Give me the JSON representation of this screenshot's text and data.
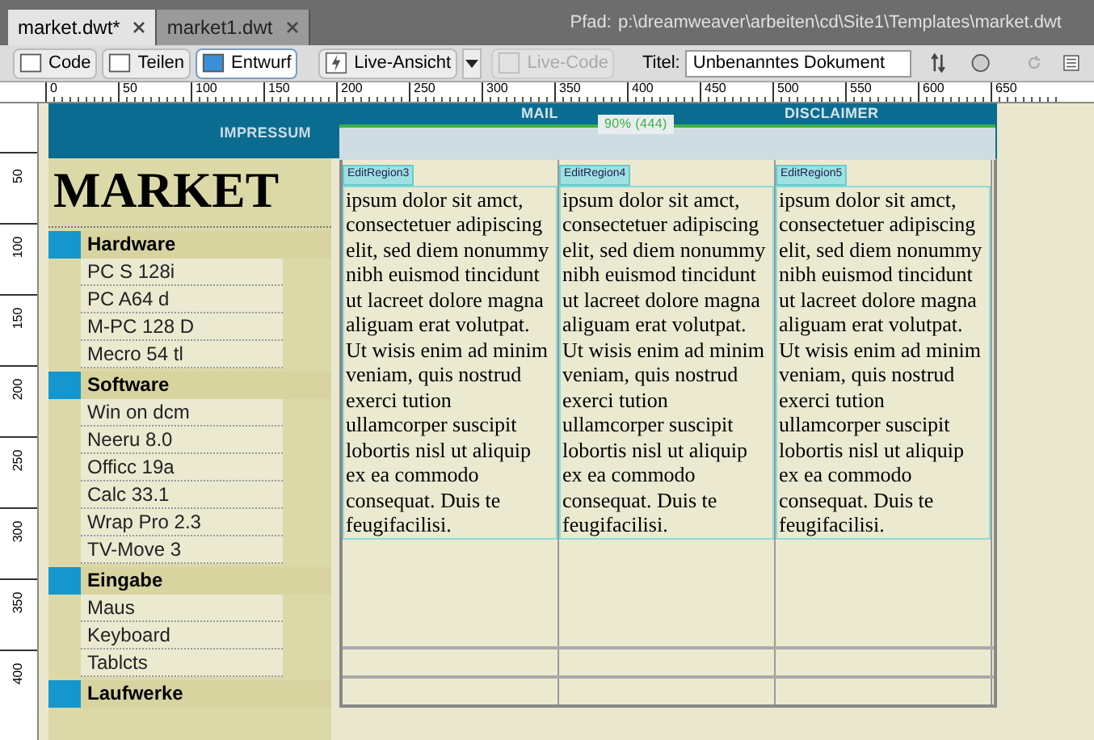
{
  "tabs": [
    {
      "label": "market.dwt*",
      "selected": true
    },
    {
      "label": "market1.dwt",
      "selected": false
    }
  ],
  "path": {
    "label": "Pfad:",
    "value": "p:\\dreamweaver\\arbeiten\\cd\\Site1\\Templates\\market.dwt"
  },
  "toolbar": {
    "views": [
      {
        "label": "Code",
        "selected": false
      },
      {
        "label": "Teilen",
        "selected": false
      },
      {
        "label": "Entwurf",
        "selected": true
      }
    ],
    "live_view": {
      "label": "Live-Ansicht"
    },
    "live_code": {
      "label": "Live-Code",
      "disabled": true
    },
    "title_label": "Titel:",
    "title_value": "Unbenanntes Dokument"
  },
  "ruler": {
    "horizontal": [
      "0",
      "50",
      "100",
      "150",
      "200",
      "250",
      "300",
      "350",
      "400",
      "450",
      "500",
      "550",
      "600",
      "650"
    ],
    "vertical": [
      "50",
      "100",
      "150",
      "200",
      "250",
      "300",
      "350",
      "400"
    ]
  },
  "nav": [
    "IMPRESSUM",
    "MAIL",
    "DISCLAIMER"
  ],
  "table_width": "90% (444)",
  "logo": "MARKET",
  "menu": [
    {
      "title": "Hardware",
      "items": [
        "PC S 128i",
        "PC A64 d",
        "M-PC 128 D",
        "Mecro 54 tl"
      ]
    },
    {
      "title": "Software",
      "items": [
        "Win on dcm",
        "Neeru 8.0",
        "Officc 19a",
        "Calc 33.1",
        "Wrap Pro 2.3",
        "TV-Move 3"
      ]
    },
    {
      "title": "Eingabe",
      "items": [
        "Maus",
        "Keyboard",
        "Tablcts"
      ]
    },
    {
      "title": "Laufwerke"
    }
  ],
  "regions": [
    {
      "name": "EditRegion3",
      "text": "ipsum dolor sit amct, consectetuer adipiscing elit, sed diem nonummy nibh euismod tincidunt ut lacreet dolore magna aliguam erat volutpat. Ut wisis enim ad minim veniam, quis nostrud exerci tution ullamcorper suscipit lobortis nisl ut aliquip ex ea commodo consequat. Duis te feugifacilisi."
    },
    {
      "name": "EditRegion4",
      "text": "ipsum dolor sit amct, consectetuer adipiscing elit, sed diem nonummy nibh euismod tincidunt ut lacreet dolore magna aliguam erat volutpat. Ut wisis enim ad minim veniam, quis nostrud exerci tution ullamcorper suscipit lobortis nisl ut aliquip ex ea commodo consequat. Duis te feugifacilisi."
    },
    {
      "name": "EditRegion5",
      "text": "ipsum dolor sit amct, consectetuer adipiscing elit, sed diem nonummy nibh euismod tincidunt ut lacreet dolore magna aliguam erat volutpat. Ut wisis enim ad minim veniam, quis nostrud exerci tution ullamcorper suscipit lobortis nisl ut aliquip ex ea commodo consequat. Duis te feugifacilisi."
    }
  ]
}
